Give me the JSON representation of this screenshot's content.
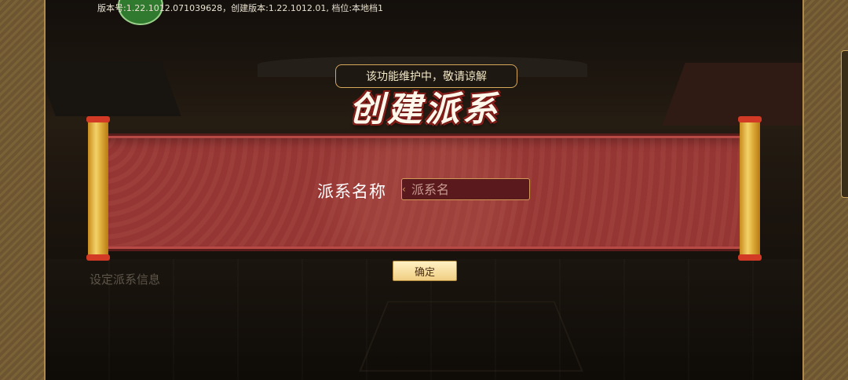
{
  "header": {
    "version_text": "版本号:1.22.1012.071039628，创建版本:1.22.1012.01, 档位:本地档1"
  },
  "notice": {
    "text": "该功能维护中，敬请谅解"
  },
  "dialog": {
    "title": "创建派系",
    "field_label": "派系名称",
    "name_input": {
      "value": "",
      "placeholder": "派系名"
    },
    "confirm_label": "确定"
  },
  "footer": {
    "info_label": "设定派系信息"
  },
  "colors": {
    "scroll_red": "#963634",
    "scroll_gold": "#f3d26a",
    "button_bg": "#f0cf83",
    "panel_brown": "#7a6236"
  }
}
